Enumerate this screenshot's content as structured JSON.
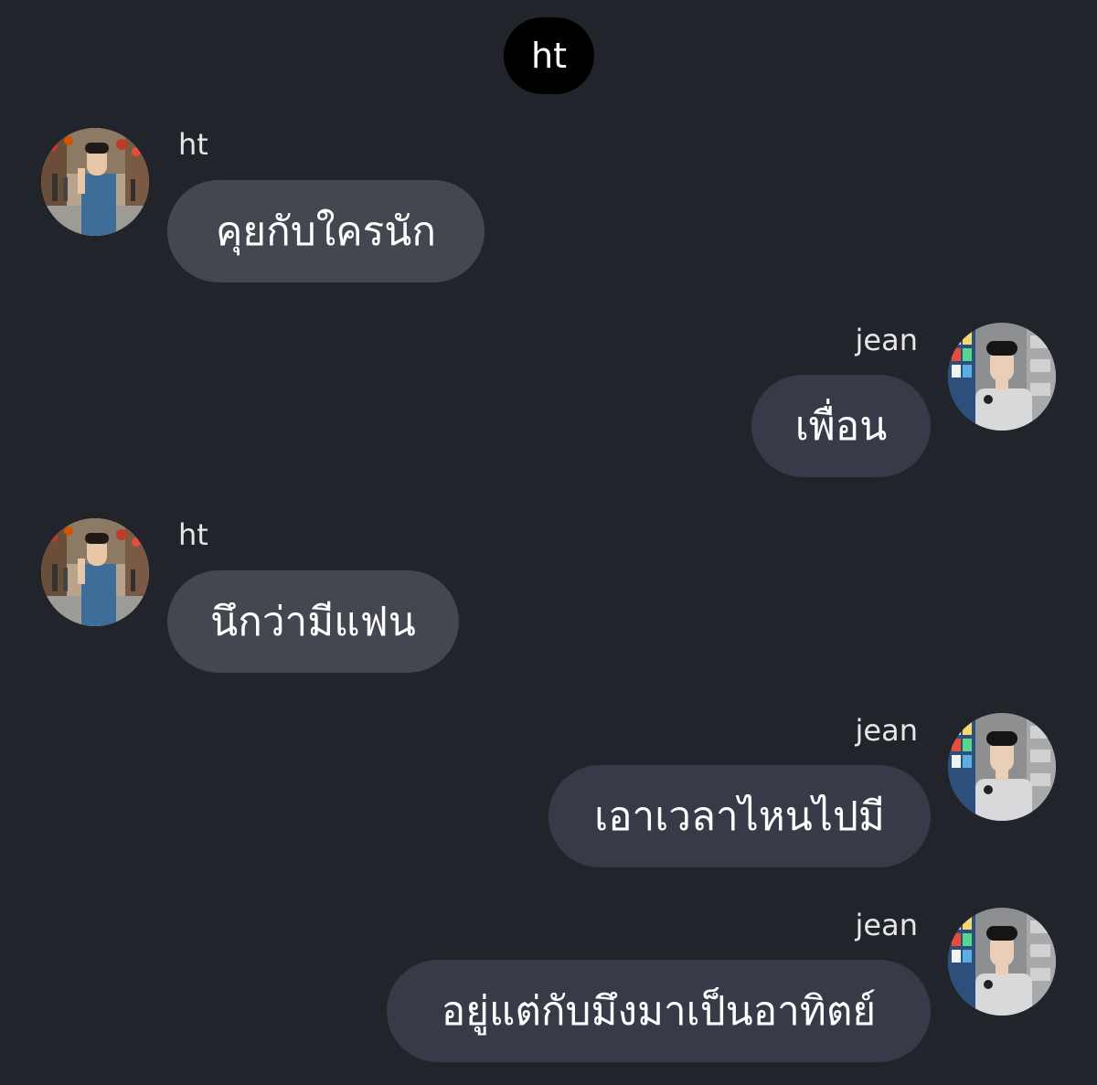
{
  "header": {
    "title": "ht"
  },
  "colors": {
    "background": "#22242c",
    "incoming_bubble": "#44474f",
    "outgoing_bubble": "#373b47",
    "header_pill": "#000000",
    "text": "#ffffff"
  },
  "messages": [
    {
      "sender": "ht",
      "side": "left",
      "text": "คุยกับใครนัก",
      "avatar": "ht-profile-photo"
    },
    {
      "sender": "jean",
      "side": "right",
      "text": "เพื่อน",
      "avatar": "jean-profile-photo"
    },
    {
      "sender": "ht",
      "side": "left",
      "text": "นึกว่ามีแฟน",
      "avatar": "ht-profile-photo"
    },
    {
      "sender": "jean",
      "side": "right",
      "text": "เอาเวลาไหนไปมี",
      "avatar": "jean-profile-photo"
    },
    {
      "sender": "jean",
      "side": "right",
      "text": "อยู่แต่กับมึงมาเป็นอาทิตย์",
      "avatar": "jean-profile-photo"
    }
  ]
}
